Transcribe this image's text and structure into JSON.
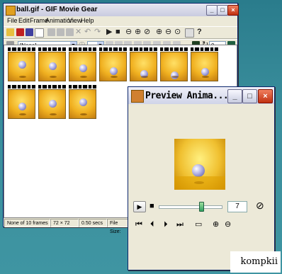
{
  "main": {
    "title": "ball.gif - GIF Movie Gear",
    "menu": [
      "File",
      "Edit",
      "Frame",
      "Animation",
      "View",
      "Help"
    ],
    "combo_value": "[None]",
    "frame_delay_value": "0",
    "status": {
      "frames": "None of 10 frames",
      "size": "72 × 72",
      "time": "0.50 secs",
      "filesize": "File Size:"
    }
  },
  "preview": {
    "title": "Preview Anima...",
    "frame_number": "7"
  },
  "watermark": "kompkii",
  "colors": {
    "titlebar": "#c9cbe0",
    "close": "#c03010",
    "desktop": "#3a8e9c"
  },
  "icons": [
    "new-icon",
    "open-icon",
    "save-icon",
    "play-icon",
    "stop-icon",
    "zoom-in-icon",
    "zoom-out-icon",
    "help-icon",
    "first-frame-icon",
    "prev-frame-icon",
    "next-frame-icon",
    "last-frame-icon",
    "minimize-icon",
    "maximize-icon",
    "close-icon"
  ]
}
